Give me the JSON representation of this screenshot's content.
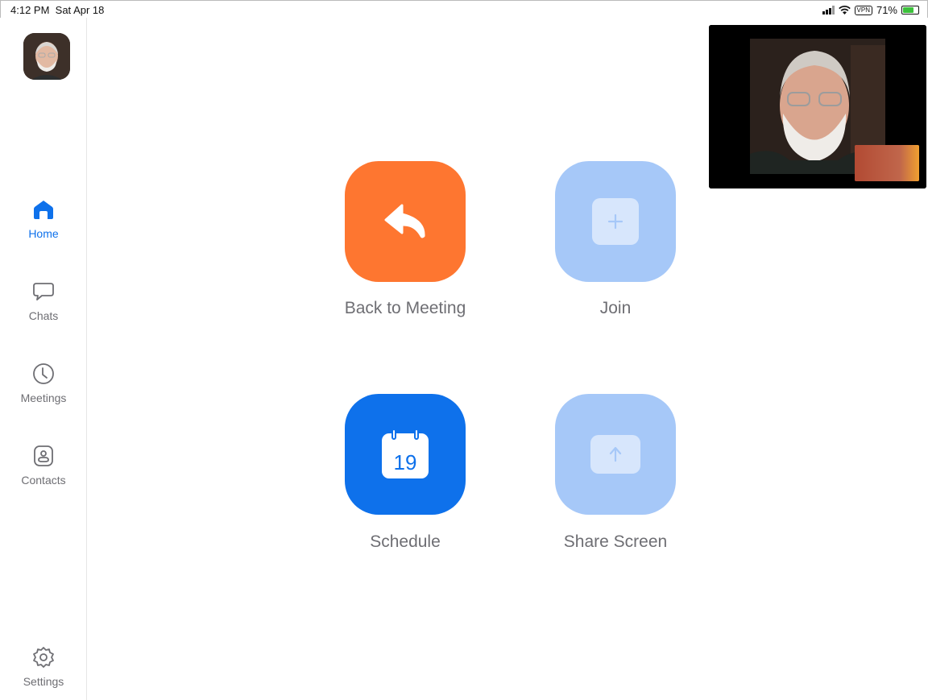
{
  "status_bar": {
    "time": "4:12 PM",
    "date": "Sat Apr 18",
    "vpn": "VPN",
    "battery": "71%",
    "battery_level": 0.71
  },
  "sidebar": {
    "items": [
      {
        "label": "Home",
        "icon": "home-icon",
        "active": true
      },
      {
        "label": "Chats",
        "icon": "chat-bubble-icon"
      },
      {
        "label": "Meetings",
        "icon": "clock-icon"
      },
      {
        "label": "Contacts",
        "icon": "contact-card-icon"
      },
      {
        "label": "Settings",
        "icon": "gear-icon"
      }
    ]
  },
  "tiles": {
    "back_to_meeting": {
      "label": "Back to Meeting",
      "color": "#fe7630",
      "icon": "reply-arrow-icon"
    },
    "join": {
      "label": "Join",
      "color": "#a6c8f8",
      "icon": "plus-icon"
    },
    "schedule": {
      "label": "Schedule",
      "color": "#0e71eb",
      "icon": "calendar-icon",
      "day": "19"
    },
    "share_screen": {
      "label": "Share Screen",
      "color": "#a6c8f8",
      "icon": "up-arrow-icon"
    }
  },
  "colors": {
    "accent": "#0e71eb",
    "inactive_text": "#6e6e73"
  }
}
